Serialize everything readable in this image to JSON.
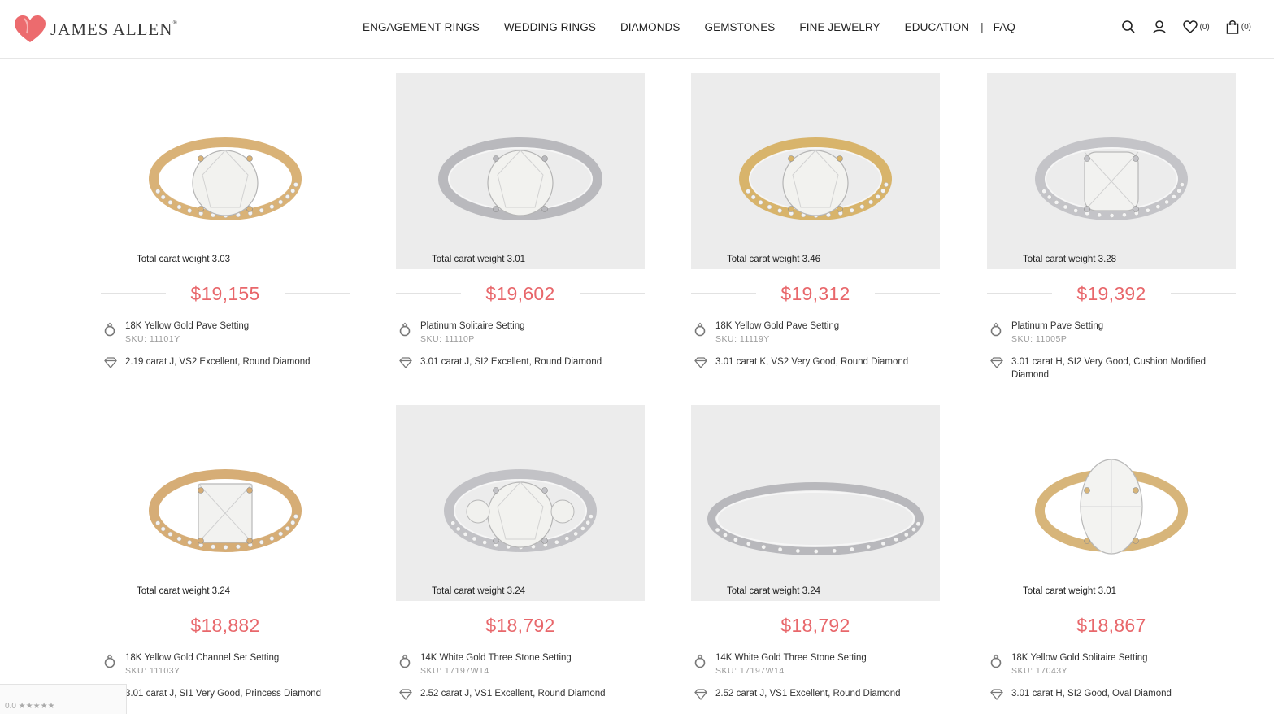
{
  "brand": {
    "name": "JAMES ALLEN",
    "reg": "®"
  },
  "nav": [
    "ENGAGEMENT RINGS",
    "WEDDING RINGS",
    "DIAMONDS",
    "GEMSTONES",
    "FINE JEWELRY",
    "EDUCATION",
    "FAQ"
  ],
  "header_icons": {
    "wishlist_count": "(0)",
    "cart_count": "(0)"
  },
  "products": [
    {
      "carat": "Total carat weight 3.03",
      "price": "$19,155",
      "setting": "18K Yellow Gold Pave Setting",
      "sku": "SKU: 11101Y",
      "diamond": "2.19 carat J, VS2 Excellent, Round Diamond",
      "metal": "#d9b277",
      "bg": "white"
    },
    {
      "carat": "Total carat weight 3.01",
      "price": "$19,602",
      "setting": "Platinum Solitaire Setting",
      "sku": "SKU: 11110P",
      "diamond": "3.01 carat J, SI2 Excellent, Round Diamond",
      "metal": "#b9b9bd",
      "bg": "gray"
    },
    {
      "carat": "Total carat weight 3.46",
      "price": "$19,312",
      "setting": "18K Yellow Gold Pave Setting",
      "sku": "SKU: 11119Y",
      "diamond": "3.01 carat K, VS2 Very Good, Round Diamond",
      "metal": "#d8b46b",
      "bg": "gray"
    },
    {
      "carat": "Total carat weight 3.28",
      "price": "$19,392",
      "setting": "Platinum Pave Setting",
      "sku": "SKU: 11005P",
      "diamond": "3.01 carat H, SI2 Very Good, Cushion Modified Diamond",
      "metal": "#c4c4c8",
      "bg": "gray"
    },
    {
      "carat": "Total carat weight 3.24",
      "price": "$18,882",
      "setting": "18K Yellow Gold Channel Set Setting",
      "sku": "SKU: 11103Y",
      "diamond": "3.01 carat J, SI1 Very Good, Princess Diamond",
      "metal": "#d6ad76",
      "bg": "white"
    },
    {
      "carat": "Total carat weight 3.24",
      "price": "$18,792",
      "setting": "14K White Gold Three Stone Setting",
      "sku": "SKU: 17197W14",
      "diamond": "2.52 carat J, VS1 Excellent, Round Diamond",
      "metal": "#c2c2c6",
      "bg": "gray"
    },
    {
      "carat": "Total carat weight 3.24",
      "price": "$18,792",
      "setting": "14K White Gold Three Stone Setting",
      "sku": "SKU: 17197W14",
      "diamond": "2.52 carat J, VS1 Excellent, Round Diamond",
      "metal": "#b8b8bc",
      "bg": "gray"
    },
    {
      "carat": "Total carat weight 3.01",
      "price": "$18,867",
      "setting": "18K Yellow Gold Solitaire Setting",
      "sku": "SKU: 17043Y",
      "diamond": "3.01 carat H, SI2 Good, Oval Diamond",
      "metal": "#d7b57a",
      "bg": "white"
    }
  ],
  "rating_widget": {
    "text": "0.0 ★★★★★"
  },
  "colors": {
    "accent": "#e8676b",
    "logo_heart": "#ec6b6e"
  }
}
